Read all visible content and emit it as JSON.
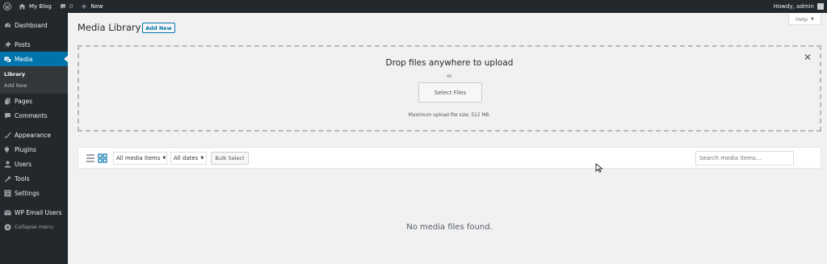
{
  "adminbar": {
    "wp_logo_icon": "wordpress-icon",
    "site_name": "My Blog",
    "comments_count": "0",
    "new_label": "New",
    "greeting": "Howdy, admin"
  },
  "sidebar": {
    "dashboard": "Dashboard",
    "posts": "Posts",
    "media": "Media",
    "library": "Library",
    "add_new": "Add New",
    "pages": "Pages",
    "comments": "Comments",
    "appearance": "Appearance",
    "plugins": "Plugins",
    "users": "Users",
    "tools": "Tools",
    "settings": "Settings",
    "wp_email_users": "WP Email Users",
    "collapse": "Collapse menu"
  },
  "help_label": "Help",
  "page": {
    "title": "Media Library",
    "add_new_button": "Add New"
  },
  "uploader": {
    "title": "Drop files anywhere to upload",
    "or": "or",
    "select_files": "Select Files",
    "max_size": "Maximum upload file size: 512 MB."
  },
  "toolbar": {
    "filter_type": "All media items",
    "filter_date": "All dates",
    "bulk_select": "Bulk Select",
    "search_placeholder": "Search media items..."
  },
  "empty_message": "No media files found.",
  "colors": {
    "accent": "#0073aa",
    "sidebar_bg": "#23282d",
    "content_bg": "#f1f1f1"
  }
}
